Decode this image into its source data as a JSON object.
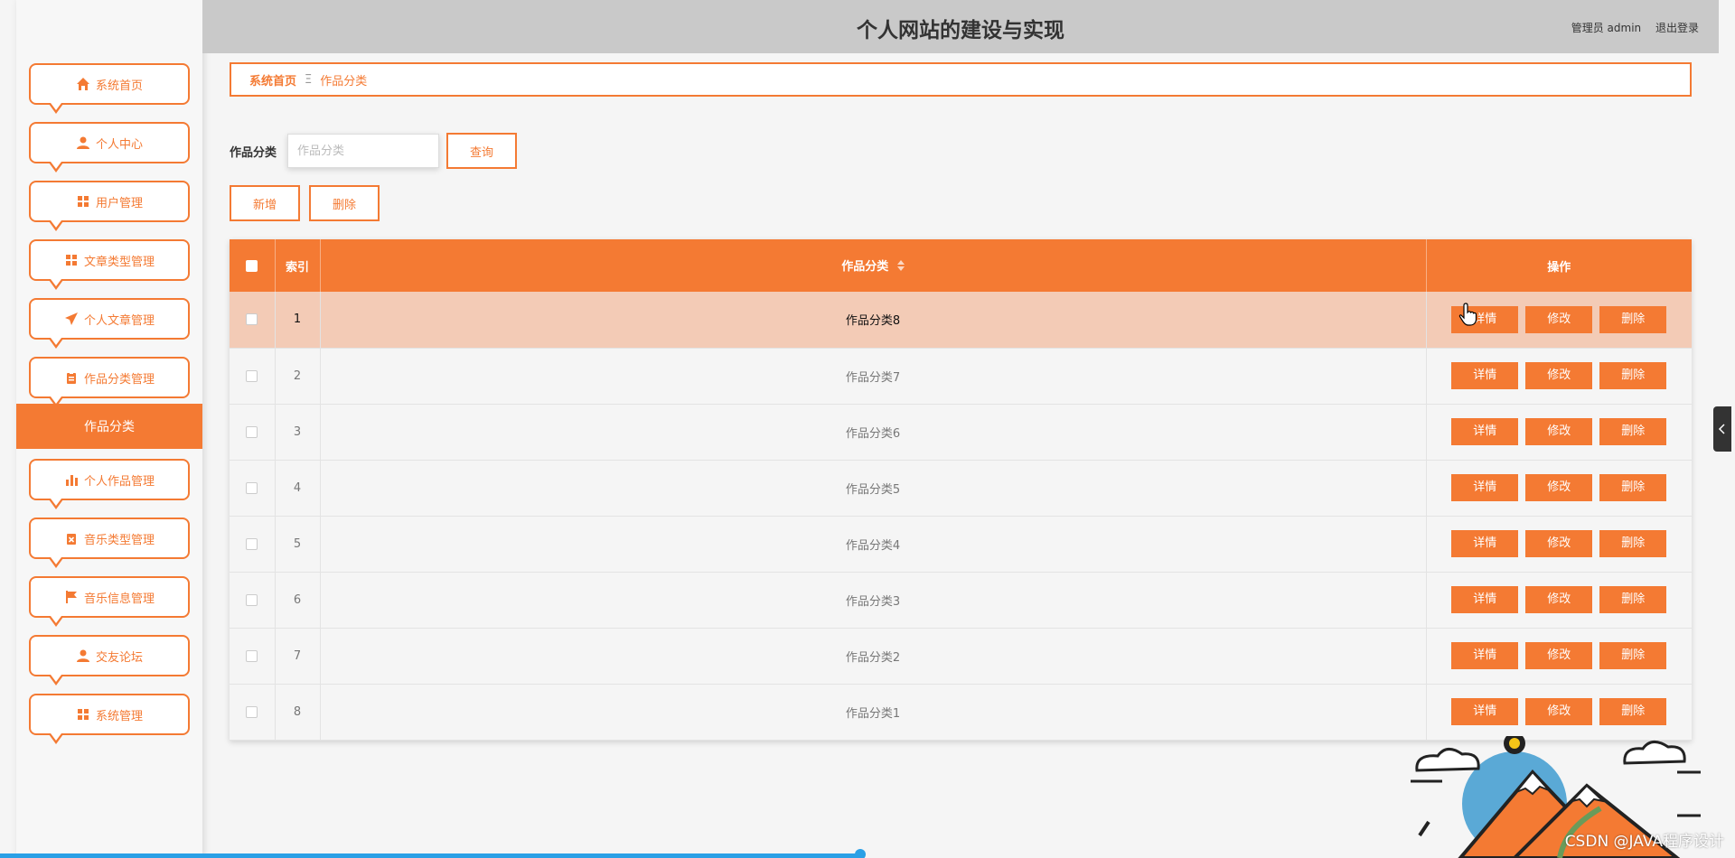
{
  "header": {
    "title": "个人网站的建设与实现",
    "user_role": "管理员 admin",
    "logout": "退出登录"
  },
  "sidebar": {
    "items": [
      {
        "label": "系统首页",
        "icon": "home-icon"
      },
      {
        "label": "个人中心",
        "icon": "user-icon"
      },
      {
        "label": "用户管理",
        "icon": "grid-icon"
      },
      {
        "label": "文章类型管理",
        "icon": "grid-icon"
      },
      {
        "label": "个人文章管理",
        "icon": "send-icon"
      },
      {
        "label": "作品分类管理",
        "icon": "clipboard-icon"
      },
      {
        "label": "个人作品管理",
        "icon": "bar-chart-icon"
      },
      {
        "label": "音乐类型管理",
        "icon": "clipboard-x-icon"
      },
      {
        "label": "音乐信息管理",
        "icon": "flag-icon"
      },
      {
        "label": "交友论坛",
        "icon": "user-icon"
      },
      {
        "label": "系统管理",
        "icon": "grid-icon"
      }
    ],
    "active_submenu": "作品分类"
  },
  "breadcrumb": {
    "home": "系统首页",
    "separator": "Ξ",
    "current": "作品分类"
  },
  "search": {
    "label": "作品分类",
    "placeholder": "作品分类",
    "query_button": "查询"
  },
  "actions": {
    "add": "新增",
    "delete": "删除"
  },
  "table": {
    "headers": {
      "index": "索引",
      "category": "作品分类",
      "ops": "操作"
    },
    "op_labels": {
      "detail": "详情",
      "edit": "修改",
      "delete": "删除"
    },
    "rows": [
      {
        "index": "1",
        "category": "作品分类8"
      },
      {
        "index": "2",
        "category": "作品分类7"
      },
      {
        "index": "3",
        "category": "作品分类6"
      },
      {
        "index": "4",
        "category": "作品分类5"
      },
      {
        "index": "5",
        "category": "作品分类4"
      },
      {
        "index": "6",
        "category": "作品分类3"
      },
      {
        "index": "7",
        "category": "作品分类2"
      },
      {
        "index": "8",
        "category": "作品分类1"
      }
    ]
  },
  "watermark": "CSDN @JAVA程序设计",
  "colors": {
    "accent": "#f47a33",
    "header_bg": "#c9c9c9",
    "row_highlight": "#f3cbb6"
  }
}
